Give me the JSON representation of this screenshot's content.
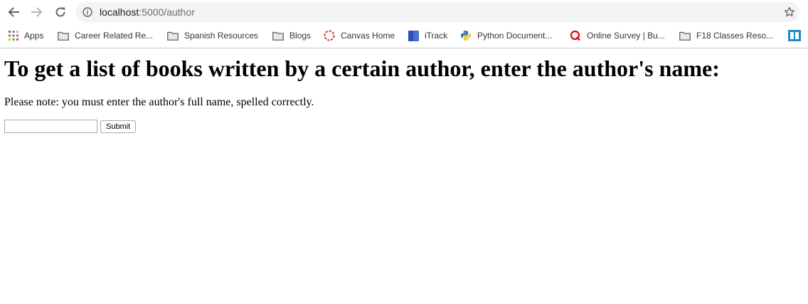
{
  "browser": {
    "url_host": "localhost",
    "url_rest": ":5000/author",
    "bookmarks": [
      {
        "label": "Apps",
        "icon": "apps-grid-icon"
      },
      {
        "label": "Career Related Re...",
        "icon": "folder-icon"
      },
      {
        "label": "Spanish Resources",
        "icon": "folder-icon"
      },
      {
        "label": "Blogs",
        "icon": "folder-icon"
      },
      {
        "label": "Canvas Home",
        "icon": "canvas-icon"
      },
      {
        "label": "iTrack",
        "icon": "itrack-icon"
      },
      {
        "label": "Python Document...",
        "icon": "python-icon"
      },
      {
        "label": "Online Survey | Bu...",
        "icon": "qualtrics-icon"
      },
      {
        "label": "F18 Classes Reso...",
        "icon": "folder-icon"
      }
    ]
  },
  "page": {
    "heading": "To get a list of books written by a certain author, enter the author's name:",
    "note": "Please note: you must enter the author's full name, spelled correctly.",
    "author_input_value": "",
    "submit_label": "Submit"
  },
  "colors": {
    "omnibox_bg": "#f1f3f4",
    "canvas_red": "#d42b1e",
    "qualtrics_red": "#e2001a",
    "itrack_blue": "#4a6fd6"
  }
}
